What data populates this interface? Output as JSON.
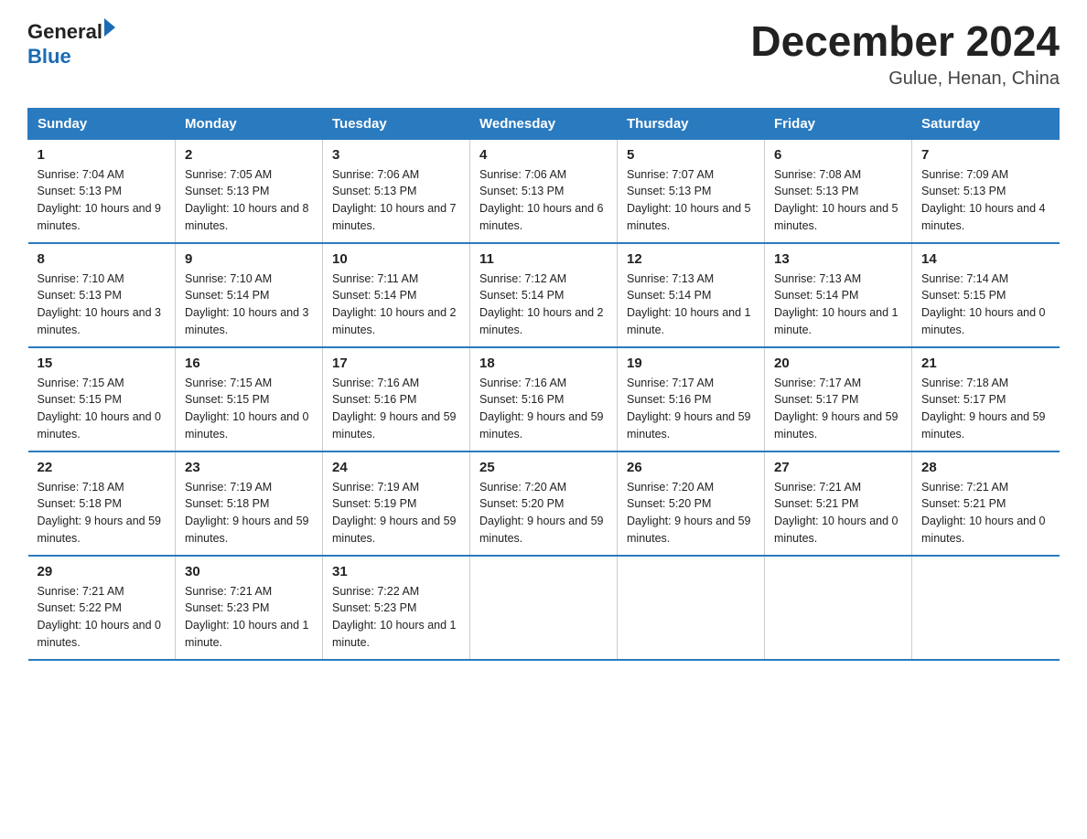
{
  "header": {
    "logo_general": "General",
    "logo_blue": "Blue",
    "month_title": "December 2024",
    "location": "Gulue, Henan, China"
  },
  "days_of_week": [
    "Sunday",
    "Monday",
    "Tuesday",
    "Wednesday",
    "Thursday",
    "Friday",
    "Saturday"
  ],
  "weeks": [
    [
      {
        "day": "1",
        "sunrise": "7:04 AM",
        "sunset": "5:13 PM",
        "daylight": "10 hours and 9 minutes."
      },
      {
        "day": "2",
        "sunrise": "7:05 AM",
        "sunset": "5:13 PM",
        "daylight": "10 hours and 8 minutes."
      },
      {
        "day": "3",
        "sunrise": "7:06 AM",
        "sunset": "5:13 PM",
        "daylight": "10 hours and 7 minutes."
      },
      {
        "day": "4",
        "sunrise": "7:06 AM",
        "sunset": "5:13 PM",
        "daylight": "10 hours and 6 minutes."
      },
      {
        "day": "5",
        "sunrise": "7:07 AM",
        "sunset": "5:13 PM",
        "daylight": "10 hours and 5 minutes."
      },
      {
        "day": "6",
        "sunrise": "7:08 AM",
        "sunset": "5:13 PM",
        "daylight": "10 hours and 5 minutes."
      },
      {
        "day": "7",
        "sunrise": "7:09 AM",
        "sunset": "5:13 PM",
        "daylight": "10 hours and 4 minutes."
      }
    ],
    [
      {
        "day": "8",
        "sunrise": "7:10 AM",
        "sunset": "5:13 PM",
        "daylight": "10 hours and 3 minutes."
      },
      {
        "day": "9",
        "sunrise": "7:10 AM",
        "sunset": "5:14 PM",
        "daylight": "10 hours and 3 minutes."
      },
      {
        "day": "10",
        "sunrise": "7:11 AM",
        "sunset": "5:14 PM",
        "daylight": "10 hours and 2 minutes."
      },
      {
        "day": "11",
        "sunrise": "7:12 AM",
        "sunset": "5:14 PM",
        "daylight": "10 hours and 2 minutes."
      },
      {
        "day": "12",
        "sunrise": "7:13 AM",
        "sunset": "5:14 PM",
        "daylight": "10 hours and 1 minute."
      },
      {
        "day": "13",
        "sunrise": "7:13 AM",
        "sunset": "5:14 PM",
        "daylight": "10 hours and 1 minute."
      },
      {
        "day": "14",
        "sunrise": "7:14 AM",
        "sunset": "5:15 PM",
        "daylight": "10 hours and 0 minutes."
      }
    ],
    [
      {
        "day": "15",
        "sunrise": "7:15 AM",
        "sunset": "5:15 PM",
        "daylight": "10 hours and 0 minutes."
      },
      {
        "day": "16",
        "sunrise": "7:15 AM",
        "sunset": "5:15 PM",
        "daylight": "10 hours and 0 minutes."
      },
      {
        "day": "17",
        "sunrise": "7:16 AM",
        "sunset": "5:16 PM",
        "daylight": "9 hours and 59 minutes."
      },
      {
        "day": "18",
        "sunrise": "7:16 AM",
        "sunset": "5:16 PM",
        "daylight": "9 hours and 59 minutes."
      },
      {
        "day": "19",
        "sunrise": "7:17 AM",
        "sunset": "5:16 PM",
        "daylight": "9 hours and 59 minutes."
      },
      {
        "day": "20",
        "sunrise": "7:17 AM",
        "sunset": "5:17 PM",
        "daylight": "9 hours and 59 minutes."
      },
      {
        "day": "21",
        "sunrise": "7:18 AM",
        "sunset": "5:17 PM",
        "daylight": "9 hours and 59 minutes."
      }
    ],
    [
      {
        "day": "22",
        "sunrise": "7:18 AM",
        "sunset": "5:18 PM",
        "daylight": "9 hours and 59 minutes."
      },
      {
        "day": "23",
        "sunrise": "7:19 AM",
        "sunset": "5:18 PM",
        "daylight": "9 hours and 59 minutes."
      },
      {
        "day": "24",
        "sunrise": "7:19 AM",
        "sunset": "5:19 PM",
        "daylight": "9 hours and 59 minutes."
      },
      {
        "day": "25",
        "sunrise": "7:20 AM",
        "sunset": "5:20 PM",
        "daylight": "9 hours and 59 minutes."
      },
      {
        "day": "26",
        "sunrise": "7:20 AM",
        "sunset": "5:20 PM",
        "daylight": "9 hours and 59 minutes."
      },
      {
        "day": "27",
        "sunrise": "7:21 AM",
        "sunset": "5:21 PM",
        "daylight": "10 hours and 0 minutes."
      },
      {
        "day": "28",
        "sunrise": "7:21 AM",
        "sunset": "5:21 PM",
        "daylight": "10 hours and 0 minutes."
      }
    ],
    [
      {
        "day": "29",
        "sunrise": "7:21 AM",
        "sunset": "5:22 PM",
        "daylight": "10 hours and 0 minutes."
      },
      {
        "day": "30",
        "sunrise": "7:21 AM",
        "sunset": "5:23 PM",
        "daylight": "10 hours and 1 minute."
      },
      {
        "day": "31",
        "sunrise": "7:22 AM",
        "sunset": "5:23 PM",
        "daylight": "10 hours and 1 minute."
      },
      null,
      null,
      null,
      null
    ]
  ]
}
